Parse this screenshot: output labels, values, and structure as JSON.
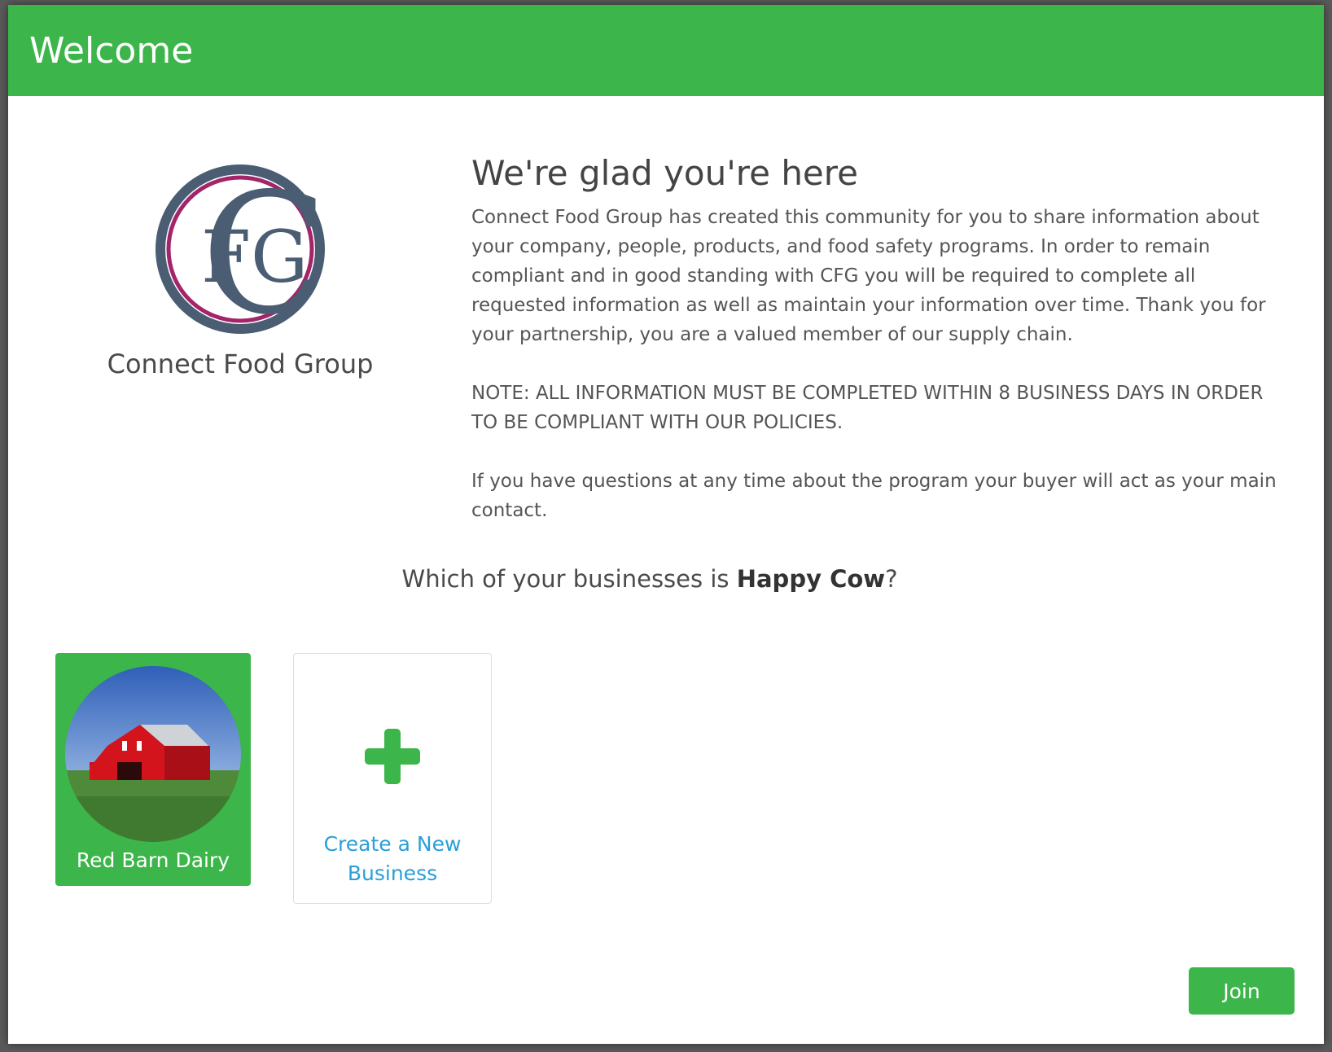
{
  "modal": {
    "title": "Welcome"
  },
  "org": {
    "name": "Connect Food Group",
    "logo_letters": "FG",
    "logo_colors": {
      "ring_outer": "#4a5d73",
      "ring_inner": "#a3246a",
      "letters": "#4a5d73"
    }
  },
  "intro": {
    "heading": "We're glad you're here",
    "paragraph1": "Connect Food Group has created this community for you to share information about your company, people, products, and food safety programs.  In order to remain compliant and in good standing with CFG you will be required to complete all requested information as well as maintain your information over time.  Thank you for your partnership, you are a valued member of our supply chain.",
    "paragraph2": "NOTE: ALL INFORMATION MUST BE COMPLETED WITHIN 8 BUSINESS DAYS  IN ORDER TO BE COMPLIANT WITH OUR POLICIES.",
    "paragraph3": "If you have questions at any time about the program your buyer will act as your main contact."
  },
  "question": {
    "prefix": "Which of your businesses is ",
    "business": "Happy Cow",
    "suffix": "?"
  },
  "businesses": [
    {
      "name": "Red Barn Dairy",
      "image": "red-barn-photo",
      "selected": true
    }
  ],
  "new_business": {
    "label": "Create a New Business",
    "icon": "plus-icon"
  },
  "actions": {
    "join_label": "Join"
  },
  "colors": {
    "accent": "#3cb54a",
    "link": "#2a9fd8"
  }
}
